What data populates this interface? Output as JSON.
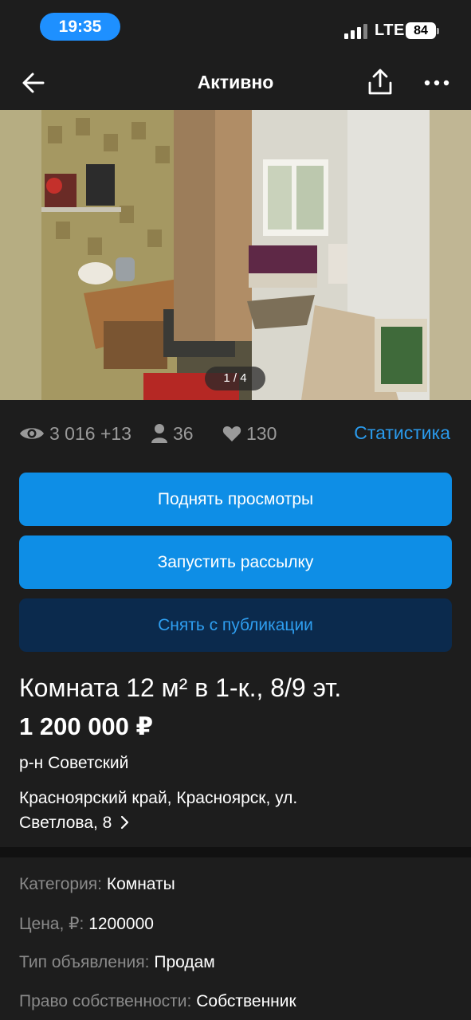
{
  "status_bar": {
    "time": "19:35",
    "network": "LTE",
    "battery": "84"
  },
  "nav": {
    "title": "Активно"
  },
  "gallery": {
    "counter": "1 / 4"
  },
  "stats": {
    "views": "3 016 +13",
    "contacts": "36",
    "favorites": "130",
    "statistics_link": "Статистика"
  },
  "buttons": {
    "boost": "Поднять просмотры",
    "mailing": "Запустить рассылку",
    "unpublish": "Снять с публикации"
  },
  "listing": {
    "title": "Комната 12 м² в 1-к., 8/9 эт.",
    "price": "1 200 000 ₽",
    "district": "р-н Советский",
    "address_line1": "Красноярский край, Красноярск, ул.",
    "address_line2": "Светлова, 8"
  },
  "params": [
    {
      "key": "Категория:",
      "value": "Комнаты"
    },
    {
      "key": "Цена, ₽:",
      "value": "1200000"
    },
    {
      "key": "Тип объявления:",
      "value": "Продам"
    },
    {
      "key": "Право собственности:",
      "value": "Собственник"
    }
  ],
  "colors": {
    "accent": "#0e8ee6",
    "link": "#2a9bed",
    "dark_button": "#0b2a4d",
    "background": "#1d1d1d"
  }
}
